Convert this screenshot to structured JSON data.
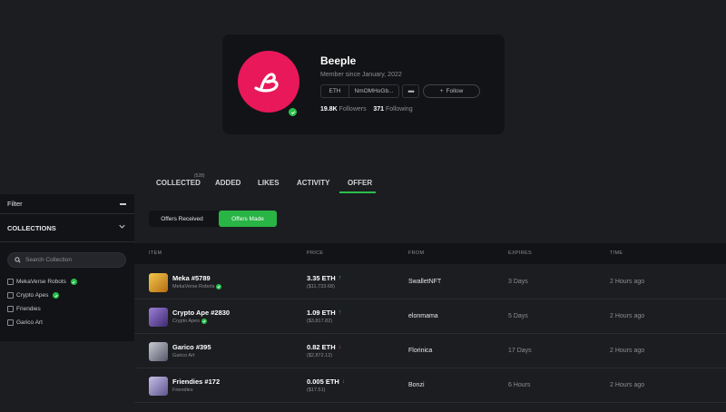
{
  "profile": {
    "name": "Beeple",
    "member_since": "Member since January, 2022",
    "chain": "ETH",
    "address": "NmOMHoGb...",
    "more": "•••",
    "follow_label": "Follow",
    "followers_count": "19.8K",
    "followers_label": "Followers",
    "following_count": "371",
    "following_label": "Following",
    "avatar_color": "#e8185a"
  },
  "tabs": [
    {
      "label": "COLLECTED",
      "count": "(528)"
    },
    {
      "label": "ADDED"
    },
    {
      "label": "LIKES"
    },
    {
      "label": "ACTIVITY"
    },
    {
      "label": "OFFER",
      "active": true
    }
  ],
  "sidebar": {
    "filter_title": "Filter",
    "collections_title": "COLLECTIONS",
    "search_placeholder": "Search Collection",
    "items": [
      {
        "label": "MekaVerse Robots",
        "verified": true
      },
      {
        "label": "Crypto Apes",
        "verified": true
      },
      {
        "label": "Friendies",
        "verified": false
      },
      {
        "label": "Garico Art",
        "verified": false
      }
    ]
  },
  "offer_toggle": {
    "received": "Offers Received",
    "made": "Offers Made"
  },
  "table": {
    "headers": {
      "item": "ITEM",
      "price": "PRICE",
      "from": "FROM",
      "expires": "EXPIRES",
      "time": "TIME"
    },
    "rows": [
      {
        "name": "Meka #5789",
        "collection": "MekaVerse Robots",
        "verified": true,
        "price": "3.35 ETH",
        "trend": "up",
        "usd": "($11,733.68)",
        "from": "SwalletNFT",
        "expires": "3 Days",
        "time": "2 Hours ago",
        "thumb_color": "#d9a21a"
      },
      {
        "name": "Crypto Ape #2830",
        "collection": "Crypto Apes",
        "verified": true,
        "price": "1.09 ETH",
        "trend": "up",
        "usd": "($3,817.82)",
        "from": "elonmama",
        "expires": "5 Days",
        "time": "2 Hours ago",
        "thumb_color": "#6b4ea8"
      },
      {
        "name": "Garico #395",
        "collection": "Garico Art",
        "verified": false,
        "price": "0.82 ETH",
        "trend": "down",
        "usd": "($2,872.12)",
        "from": "Florinica",
        "expires": "17 Days",
        "time": "2 Hours ago",
        "thumb_color": "#9a9ca8"
      },
      {
        "name": "Friendies #172",
        "collection": "Friendies",
        "verified": false,
        "price": "0.005 ETH",
        "trend": "down",
        "usd": "($17.51)",
        "from": "Bonzi",
        "expires": "6 Hours",
        "time": "2 Hours ago",
        "thumb_color": "#8a7fb6"
      }
    ]
  },
  "colors": {
    "accent": "#2bbf4a",
    "down": "#e8344a"
  }
}
